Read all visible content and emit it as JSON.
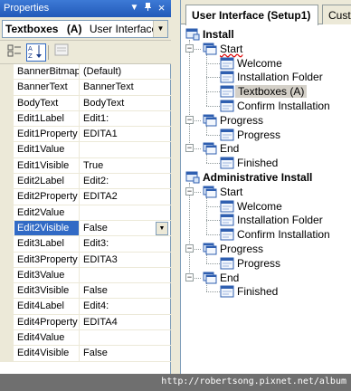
{
  "properties_panel": {
    "title": "Properties",
    "title_buttons": {
      "dropdown": "▼",
      "pin": "ᵖ",
      "close": "×"
    },
    "object": {
      "name": "Textboxes",
      "qualifier": "(A)",
      "type": "User Interface"
    },
    "toolbar": {
      "categorized": "categorized-icon",
      "alphabetical": "alphabetical-icon",
      "property_pages": "property-pages-icon"
    },
    "rows": [
      {
        "name": "BannerBitmap",
        "value": "(Default)"
      },
      {
        "name": "BannerText",
        "value": "BannerText"
      },
      {
        "name": "BodyText",
        "value": "BodyText"
      },
      {
        "name": "Edit1Label",
        "value": "Edit1:"
      },
      {
        "name": "Edit1Property",
        "value": "EDITA1"
      },
      {
        "name": "Edit1Value",
        "value": ""
      },
      {
        "name": "Edit1Visible",
        "value": "True"
      },
      {
        "name": "Edit2Label",
        "value": "Edit2:"
      },
      {
        "name": "Edit2Property",
        "value": "EDITA2"
      },
      {
        "name": "Edit2Value",
        "value": ""
      },
      {
        "name": "Edit2Visible",
        "value": "False",
        "selected": true
      },
      {
        "name": "Edit3Label",
        "value": "Edit3:"
      },
      {
        "name": "Edit3Property",
        "value": "EDITA3"
      },
      {
        "name": "Edit3Value",
        "value": ""
      },
      {
        "name": "Edit3Visible",
        "value": "False"
      },
      {
        "name": "Edit4Label",
        "value": "Edit4:"
      },
      {
        "name": "Edit4Property",
        "value": "EDITA4"
      },
      {
        "name": "Edit4Value",
        "value": ""
      },
      {
        "name": "Edit4Visible",
        "value": "False"
      }
    ]
  },
  "editor": {
    "tabs": [
      {
        "label": "User Interface (Setup1)",
        "active": true
      },
      {
        "label": "Cust"
      }
    ],
    "tree": [
      {
        "label": "Install",
        "bold": true,
        "level": 0,
        "icon": "install-icon"
      },
      {
        "label": "Start",
        "level": 1,
        "icon": "dialog-group-icon",
        "squiggle": true
      },
      {
        "label": "Welcome",
        "level": 2,
        "icon": "dialog-icon"
      },
      {
        "label": "Installation Folder",
        "level": 2,
        "icon": "dialog-icon"
      },
      {
        "label": "Textboxes  (A)",
        "level": 2,
        "icon": "dialog-icon",
        "selected": true
      },
      {
        "label": "Confirm Installation",
        "level": 2,
        "icon": "dialog-icon"
      },
      {
        "label": "Progress",
        "level": 1,
        "icon": "dialog-group-icon"
      },
      {
        "label": "Progress",
        "level": 2,
        "icon": "dialog-icon"
      },
      {
        "label": "End",
        "level": 1,
        "icon": "dialog-group-icon"
      },
      {
        "label": "Finished",
        "level": 2,
        "icon": "dialog-icon"
      },
      {
        "label": "Administrative Install",
        "bold": true,
        "level": 0,
        "icon": "install-icon"
      },
      {
        "label": "Start",
        "level": 1,
        "icon": "dialog-group-icon"
      },
      {
        "label": "Welcome",
        "level": 2,
        "icon": "dialog-icon"
      },
      {
        "label": "Installation Folder",
        "level": 2,
        "icon": "dialog-icon"
      },
      {
        "label": "Confirm Installation",
        "level": 2,
        "icon": "dialog-icon"
      },
      {
        "label": "Progress",
        "level": 1,
        "icon": "dialog-group-icon"
      },
      {
        "label": "Progress",
        "level": 2,
        "icon": "dialog-icon"
      },
      {
        "label": "End",
        "level": 1,
        "icon": "dialog-group-icon"
      },
      {
        "label": "Finished",
        "level": 2,
        "icon": "dialog-icon"
      }
    ]
  },
  "watermark": "http://robertsong.pixnet.net/album",
  "colors": {
    "title_bar": "#2f67c7",
    "selection": "#316ac5",
    "chrome": "#ece9d8"
  }
}
